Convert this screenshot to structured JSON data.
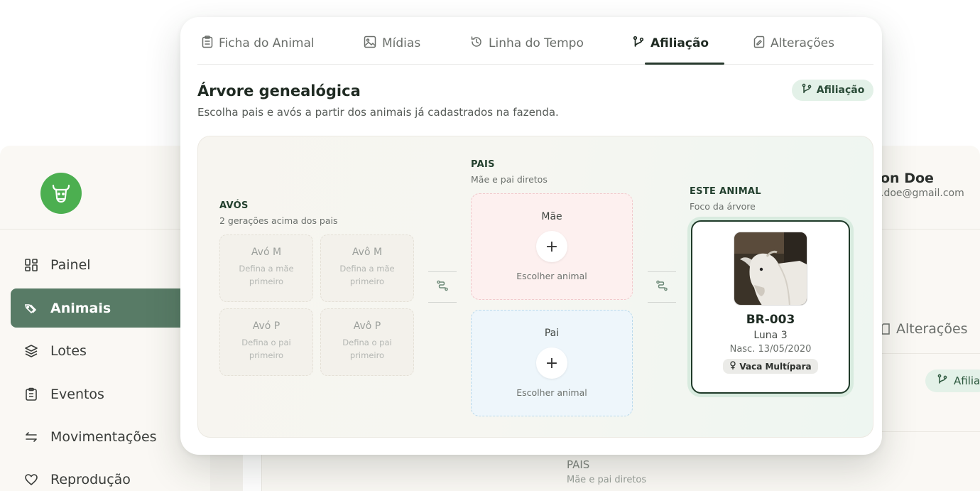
{
  "sidebar": {
    "items": [
      {
        "label": "Painel"
      },
      {
        "label": "Animais"
      },
      {
        "label": "Lotes"
      },
      {
        "label": "Eventos"
      },
      {
        "label": "Movimentações"
      },
      {
        "label": "Reprodução"
      }
    ]
  },
  "background": {
    "user_name": "on Doe",
    "user_email": ".doe@gmail.com",
    "tab_alteracoes": "Alterações",
    "pill_label": "Afilia",
    "pais_label": "PAIS",
    "pais_sub": "Mãe e pai diretos"
  },
  "tabs": [
    {
      "label": "Ficha do Animal",
      "icon": "clipboard-icon"
    },
    {
      "label": "Mídias",
      "icon": "image-icon"
    },
    {
      "label": "Linha do Tempo",
      "icon": "history-icon"
    },
    {
      "label": "Afiliação",
      "icon": "branch-icon",
      "active": true
    },
    {
      "label": "Alterações",
      "icon": "edit-file-icon"
    }
  ],
  "header": {
    "title": "Árvore genealógica",
    "subtitle": "Escolha pais e avós a partir dos animais já cadastrados na fazenda.",
    "badge": "Afiliação"
  },
  "tree": {
    "avos": {
      "label": "AVÓS",
      "sub": "2 gerações acima dos pais",
      "cards": [
        {
          "title": "Avó M",
          "sub": "Defina a mãe primeiro"
        },
        {
          "title": "Avô M",
          "sub": "Defina a mãe primeiro"
        },
        {
          "title": "Avó P",
          "sub": "Defina o pai primeiro"
        },
        {
          "title": "Avô P",
          "sub": "Defina o pai primeiro"
        }
      ]
    },
    "pais": {
      "label": "PAIS",
      "sub": "Mãe e pai diretos",
      "mae": {
        "title": "Mãe",
        "plus": "+",
        "action": "Escolher animal"
      },
      "pai": {
        "title": "Pai",
        "plus": "+",
        "action": "Escolher animal"
      }
    },
    "este_animal": {
      "label": "ESTE ANIMAL",
      "sub": "Foco da árvore",
      "id": "BR-003",
      "name": "Luna 3",
      "birth": "Nasc. 13/05/2020",
      "tag": "Vaca Multípara"
    }
  },
  "colors": {
    "brand_green": "#4caf50",
    "sidebar_active": "#587b66",
    "dark_green": "#1f3a29",
    "badge_bg": "#e3f1e8",
    "mae_bg": "#fdf0ef",
    "pai_bg": "#eef6fb"
  }
}
